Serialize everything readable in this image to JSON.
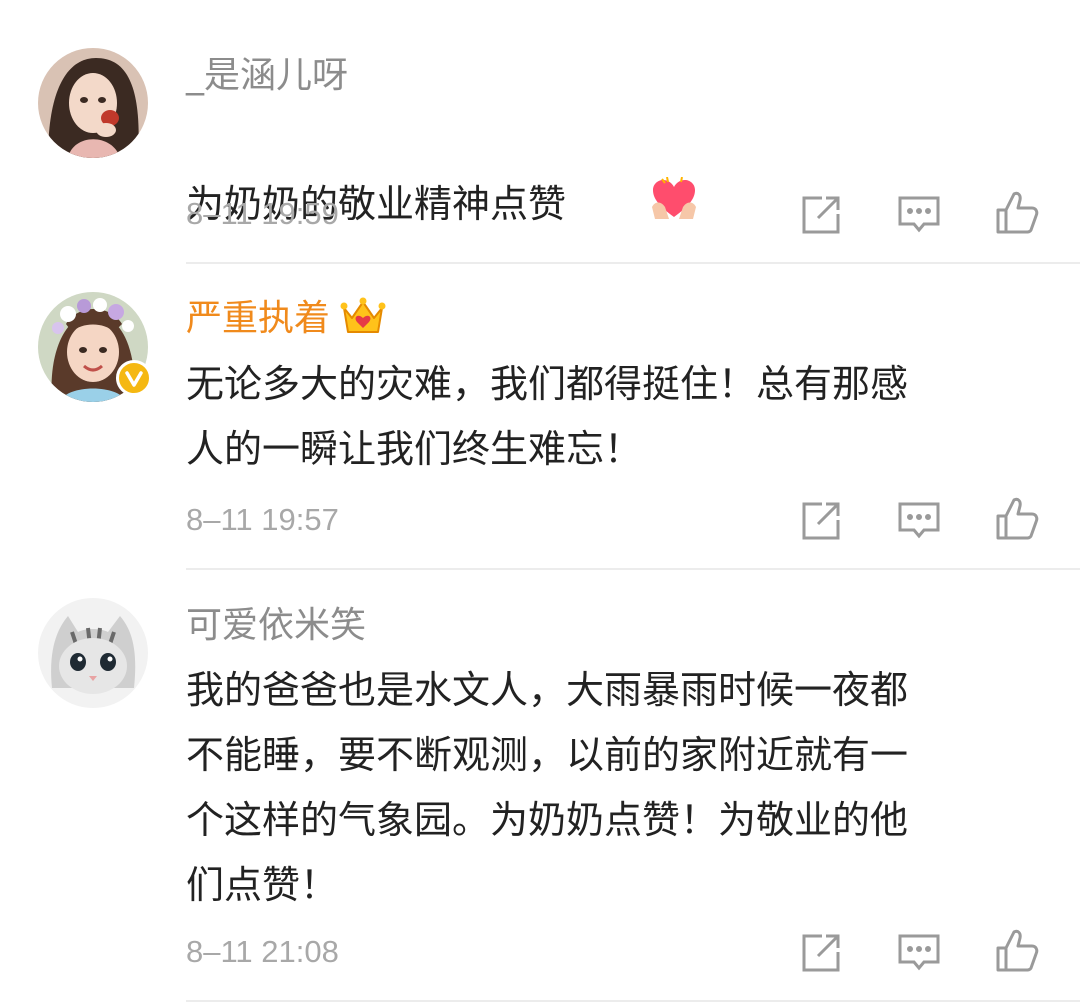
{
  "comments": [
    {
      "username": "_是涵儿呀",
      "text": "为奶奶的敬业精神点赞",
      "time": "8–11 19:59",
      "avatar_icon": "girl-portrait-avatar",
      "emoji_icon": "heart-hands-emoji"
    },
    {
      "username": "严重执着",
      "text": "无论多大的灾难，我们都得挺住！总有那感\n人的一瞬让我们终生难忘！",
      "time": "8–11 19:57",
      "avatar_icon": "child-flower-crown-avatar",
      "badge_icon": "crown-vip-icon",
      "verified_icon": "verified-badge-icon"
    },
    {
      "username": "可爱依米笑",
      "text": "我的爸爸也是水文人，大雨暴雨时候一夜都\n不能睡，要不断观测，以前的家附近就有一\n个这样的气象园。为奶奶点赞！为敬业的他\n们点赞！",
      "time": "8–11 21:08",
      "avatar_icon": "kitten-avatar"
    }
  ],
  "actions": [
    "share-icon",
    "comment-icon",
    "like-icon"
  ],
  "colors": {
    "vip_name": "#f08a1c",
    "meta": "#a8a8a8",
    "body": "#222222",
    "icon": "#9a9a9a"
  }
}
